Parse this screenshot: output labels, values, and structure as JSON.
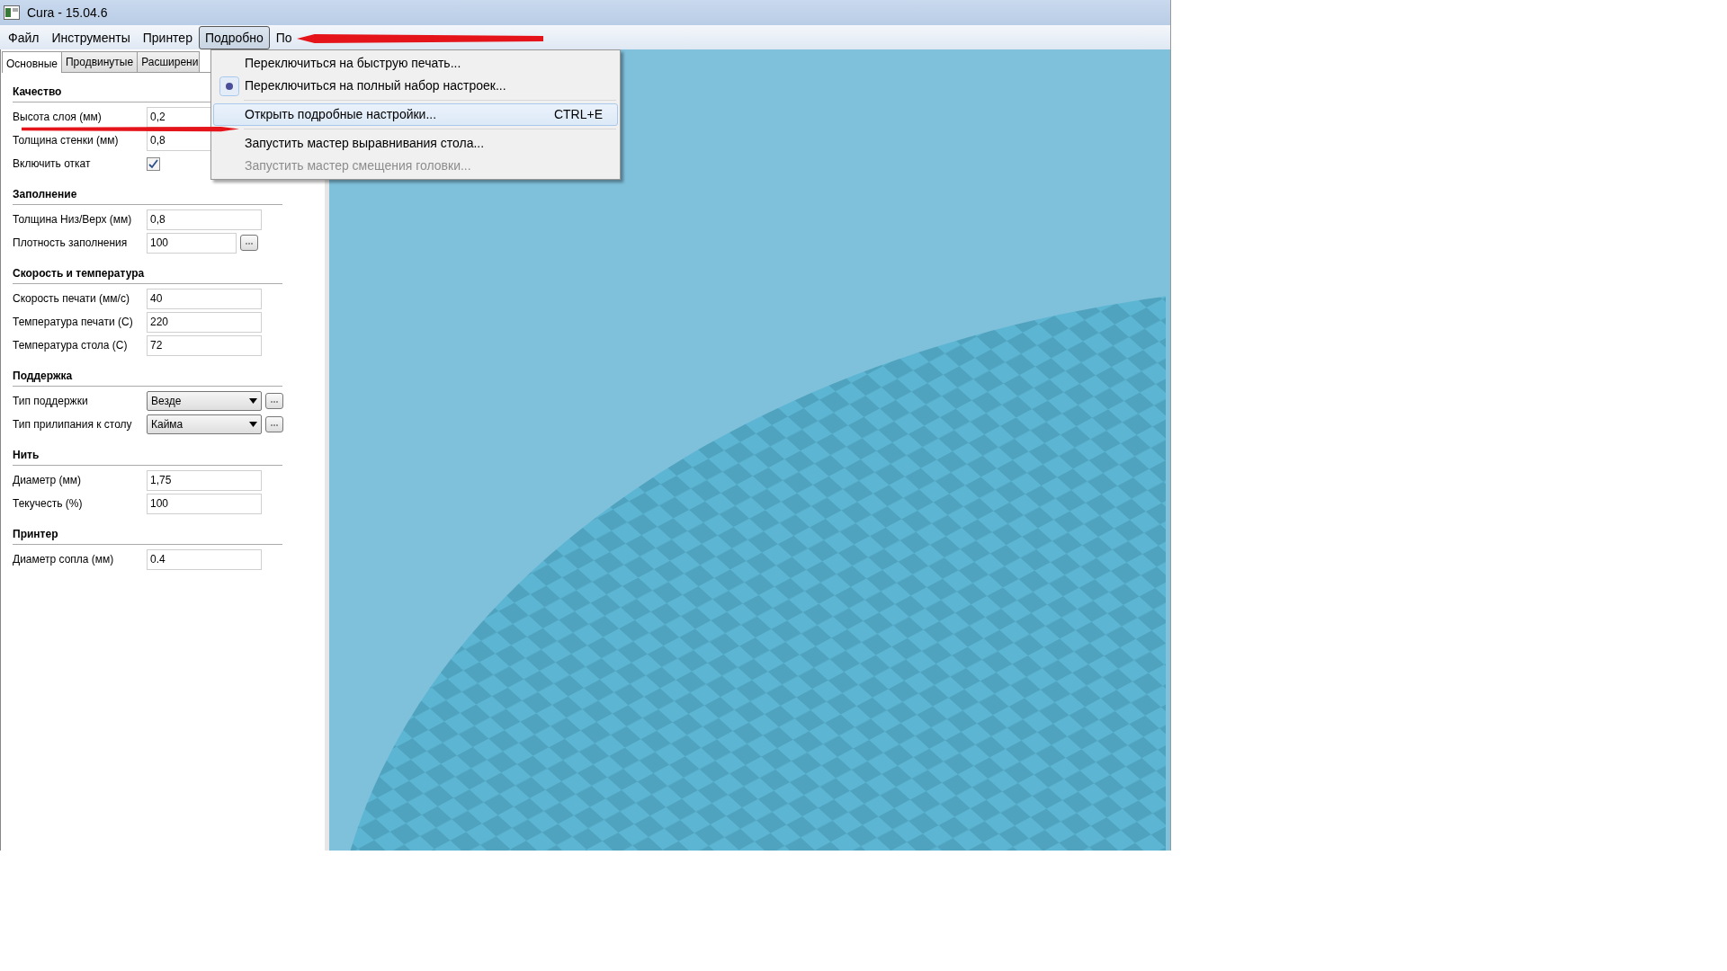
{
  "window": {
    "title": "Cura - 15.04.6"
  },
  "menubar": [
    {
      "label": "Файл",
      "selected": false
    },
    {
      "label": "Инструменты",
      "selected": false
    },
    {
      "label": "Принтер",
      "selected": false
    },
    {
      "label": "Подробно",
      "selected": true
    },
    {
      "label": "По",
      "selected": false
    }
  ],
  "dropdown": [
    {
      "label": "Переключиться на быструю печать...",
      "checked": false,
      "highlighted": false,
      "disabled": false,
      "separator_after": false
    },
    {
      "label": "Переключиться на полный набор настроек...",
      "checked": true,
      "highlighted": false,
      "disabled": false,
      "separator_after": true
    },
    {
      "label": "Открыть подробные настройки...",
      "shortcut": "CTRL+E",
      "checked": false,
      "highlighted": true,
      "disabled": false,
      "separator_after": true
    },
    {
      "label": "Запустить мастер выравнивания стола...",
      "checked": false,
      "highlighted": false,
      "disabled": false,
      "separator_after": false
    },
    {
      "label": "Запустить мастер смещения головки...",
      "checked": false,
      "highlighted": false,
      "disabled": true,
      "separator_after": false
    }
  ],
  "tabs": [
    {
      "label": "Основные",
      "selected": true
    },
    {
      "label": "Продвинутые",
      "selected": false
    },
    {
      "label": "Расширени",
      "selected": false
    }
  ],
  "sections": [
    {
      "title": "Качество",
      "rows": [
        {
          "kind": "text",
          "label": "Высота слоя (мм)",
          "value": "0,2",
          "more_button": false
        },
        {
          "kind": "text",
          "label": "Толщина стенки (мм)",
          "value": "0,8",
          "more_button": false
        },
        {
          "kind": "checkbox",
          "label": "Включить откат",
          "checked": true
        }
      ]
    },
    {
      "title": "Заполнение",
      "rows": [
        {
          "kind": "text",
          "label": "Толщина Низ/Верх (мм)",
          "value": "0,8",
          "more_button": false
        },
        {
          "kind": "text",
          "label": "Плотность заполнения",
          "value": "100",
          "more_button": true
        }
      ]
    },
    {
      "title": "Скорость и температура",
      "rows": [
        {
          "kind": "text",
          "label": "Скорость печати (мм/с)",
          "value": "40",
          "more_button": false
        },
        {
          "kind": "text",
          "label": "Температура печати (С)",
          "value": "220",
          "more_button": false
        },
        {
          "kind": "text",
          "label": "Температура стола (С)",
          "value": "72",
          "more_button": false
        }
      ]
    },
    {
      "title": "Поддержка",
      "rows": [
        {
          "kind": "select",
          "label": "Тип поддержки",
          "value": "Везде",
          "more_button": true
        },
        {
          "kind": "select",
          "label": "Тип прилипания к столу",
          "value": "Кайма",
          "more_button": true
        }
      ]
    },
    {
      "title": "Нить",
      "rows": [
        {
          "kind": "text",
          "label": "Диаметр (мм)",
          "value": "1,75",
          "more_button": false
        },
        {
          "kind": "text",
          "label": "Текучесть (%)",
          "value": "100",
          "more_button": false
        }
      ]
    },
    {
      "title": "Принтер",
      "rows": [
        {
          "kind": "text",
          "label": "Диаметр сопла (мм)",
          "value": "0.4",
          "more_button": false
        }
      ]
    }
  ]
}
